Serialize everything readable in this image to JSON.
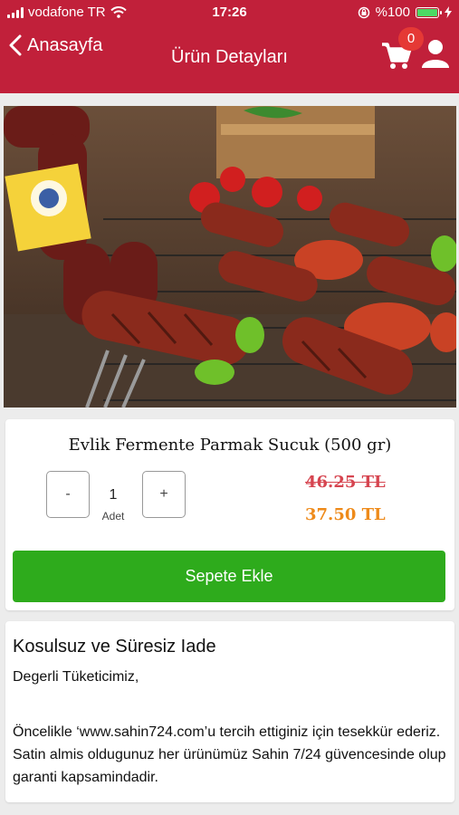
{
  "status_bar": {
    "carrier": "vodafone TR",
    "time": "17:26",
    "battery": "%100"
  },
  "nav": {
    "back_label": "Anasayfa",
    "title": "Ürün Detayları",
    "cart_count": "0"
  },
  "product": {
    "name": "Evlik Fermente Parmak Sucuk (500 gr)",
    "quantity": "1",
    "quantity_unit": "Adet",
    "minus_label": "-",
    "plus_label": "+",
    "old_price": "46.25 TL",
    "new_price": "37.50 TL",
    "add_to_cart_label": "Sepete Ekle"
  },
  "info": {
    "title": "Kosulsuz ve Süresiz Iade",
    "greeting": "Degerli Tüketicimiz,",
    "body": "Öncelikle ‘www.sahin724.com’u tercih ettiginiz için tesekkür ederiz. Satin almis oldugunuz her ürünümüz Sahin 7/24 güvencesinde olup garanti kapsamindadir."
  },
  "colors": {
    "header": "#c1203a",
    "add_button": "#2eab1c",
    "old_price": "#d64550",
    "new_price": "#ee8a1a",
    "badge": "#e53935"
  },
  "icons": [
    "signal-icon",
    "wifi-icon",
    "lock-rotation-icon",
    "battery-icon",
    "charging-icon",
    "back-chevron-icon",
    "cart-icon",
    "user-icon"
  ]
}
